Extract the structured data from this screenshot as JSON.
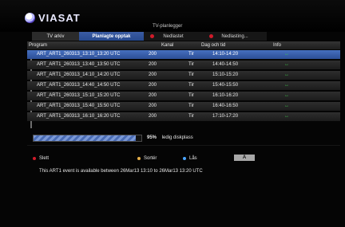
{
  "logo_text": "VIASAT",
  "title": "TV-planlegger",
  "tabs": [
    {
      "label": "TV arkiv"
    },
    {
      "label": "Planlagte opptak"
    },
    {
      "label": "Nedlastet"
    },
    {
      "label": "Nedlasting..."
    }
  ],
  "columns": {
    "program": "Program",
    "kanal": "Kanal",
    "dag": "Dag och tid",
    "info": "Info"
  },
  "rows": [
    {
      "program": "ART_ART1_260313_13:10_13:20 UTC",
      "kanal": "200",
      "dag": "Tir",
      "tid": "14:10-14:20",
      "info": "↔"
    },
    {
      "program": "ART_ART1_260313_13:40_13:50 UTC",
      "kanal": "200",
      "dag": "Tir",
      "tid": "14:40-14:50",
      "info": "↔"
    },
    {
      "program": "ART_ART1_260313_14:10_14:20 UTC",
      "kanal": "200",
      "dag": "Tir",
      "tid": "15:10-15:20",
      "info": "↔"
    },
    {
      "program": "ART_ART1_260313_14:40_14:50 UTC",
      "kanal": "200",
      "dag": "Tir",
      "tid": "15:40-15:50",
      "info": "↔"
    },
    {
      "program": "ART_ART1_260313_15:10_15:20 UTC",
      "kanal": "200",
      "dag": "Tir",
      "tid": "16:10-16:20",
      "info": "↔"
    },
    {
      "program": "ART_ART1_260313_15:40_15:50 UTC",
      "kanal": "200",
      "dag": "Tir",
      "tid": "16:40-16:50",
      "info": "↔"
    },
    {
      "program": "ART_ART1_260313_16:10_16:20 UTC",
      "kanal": "200",
      "dag": "Tir",
      "tid": "17:10-17:20",
      "info": "↔"
    }
  ],
  "disk": {
    "percent_label": "95%",
    "label": "ledig diskplass",
    "fill_fraction": 0.95
  },
  "legend": {
    "delete": {
      "label": "Slett",
      "color": "#d11b2a"
    },
    "sort": {
      "label": "Sortér",
      "color": "#e7b04a"
    },
    "lock": {
      "label": "Lås",
      "color": "#4aa6ff"
    },
    "key": "A"
  },
  "info_text": "This ART1 event is available between 26Mar13 13:10 to 26Mar13 13:20 UTC",
  "colors": {
    "selected_row": "#3f67b6",
    "accent": "#2c4e96",
    "arrow": "#3ecb4b"
  }
}
